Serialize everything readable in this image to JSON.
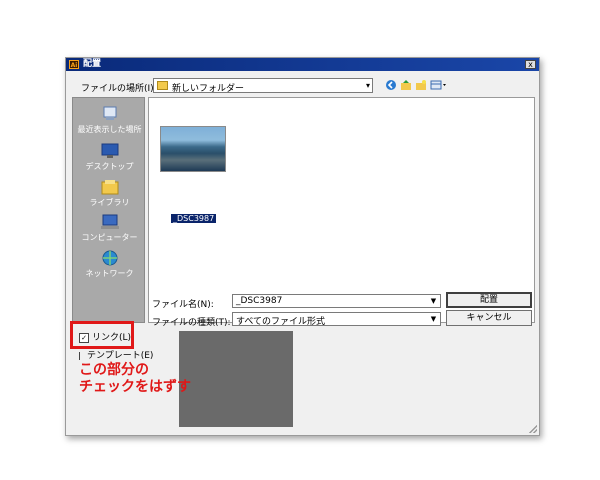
{
  "window": {
    "title": "配置",
    "app_icon": "Ai",
    "close_label": "x"
  },
  "lookin": {
    "label": "ファイルの場所(I):",
    "value": "新しいフォルダー"
  },
  "toolbar": {
    "back_icon": "back-icon",
    "up_icon": "up-folder-icon",
    "new_folder_icon": "new-folder-icon",
    "views_icon": "views-menu-icon"
  },
  "places": [
    {
      "label": "最近表示した場所",
      "icon": "recent-places-icon"
    },
    {
      "label": "デスクトップ",
      "icon": "desktop-icon"
    },
    {
      "label": "ライブラリ",
      "icon": "library-icon"
    },
    {
      "label": "コンピューター",
      "icon": "computer-icon"
    },
    {
      "label": "ネットワーク",
      "icon": "network-icon"
    }
  ],
  "files": [
    {
      "name": "_DSC3987",
      "selected": true
    }
  ],
  "filename": {
    "label": "ファイル名(N):",
    "value": "_DSC3987"
  },
  "filetype": {
    "label": "ファイルの種類(T):",
    "value": "すべてのファイル形式"
  },
  "buttons": {
    "place": "配置",
    "cancel": "キャンセル"
  },
  "options": {
    "link": {
      "label": "リンク(L)",
      "checked": true
    },
    "template": {
      "label": "テンプレート(E)",
      "checked": false
    }
  },
  "annotation": {
    "line1": "この部分の",
    "line2": "チェックをはずす"
  },
  "colors": {
    "annotation": "#e01818",
    "titlebar": "#0a246a",
    "places_bg": "#a9a9a9"
  }
}
